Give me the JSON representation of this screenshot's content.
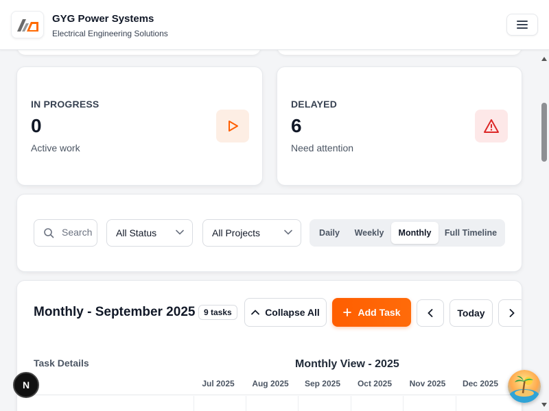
{
  "header": {
    "title": "GYG Power Systems",
    "subtitle": "Electrical Engineering Solutions",
    "menu_icon": "hamburger-icon"
  },
  "stats": [
    {
      "label": "IN PROGRESS",
      "value": "0",
      "sub": "Active work",
      "icon": "play-icon",
      "color": "#ff5e00",
      "bg": "#fdeee4"
    },
    {
      "label": "DELAYED",
      "value": "6",
      "sub": "Need attention",
      "icon": "alert-triangle-icon",
      "color": "#dc2626",
      "bg": "#fde8e8"
    }
  ],
  "filters": {
    "search_placeholder": "Search",
    "status": "All Status",
    "projects": "All Projects",
    "views": [
      "Daily",
      "Weekly",
      "Monthly",
      "Full Timeline"
    ],
    "active_view": "Monthly"
  },
  "timeline": {
    "title": "Monthly - September 2025",
    "task_count": "9 tasks",
    "collapse_label": "Collapse All",
    "add_task_label": "Add Task",
    "today_label": "Today",
    "task_details_label": "Task Details",
    "view_title": "Monthly View - 2025",
    "months": [
      "Jul 2025",
      "Aug 2025",
      "Sep 2025",
      "Oct 2025",
      "Nov 2025",
      "Dec 2025"
    ]
  },
  "floating": {
    "dev_badge": "N"
  },
  "colors": {
    "accent": "#ff5e00",
    "danger": "#dc2626"
  }
}
